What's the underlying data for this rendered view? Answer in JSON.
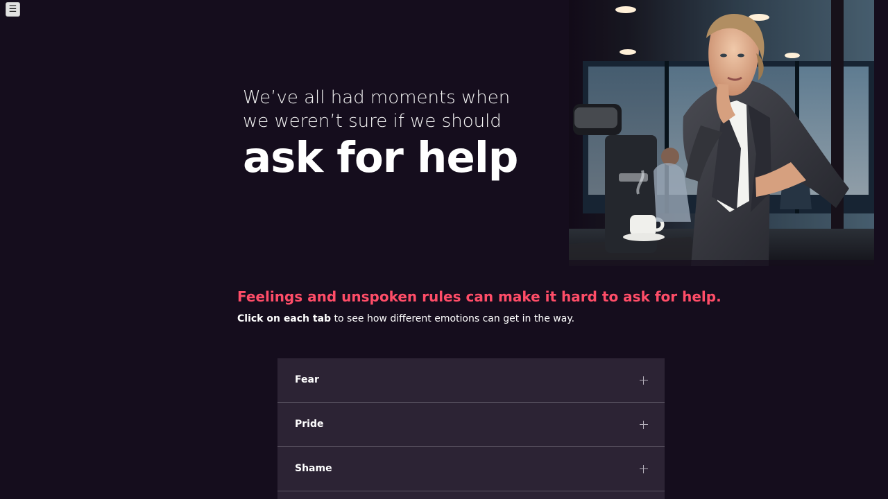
{
  "menu": {
    "icon": "menu-icon",
    "symbol": "☰"
  },
  "hero": {
    "line1": "We’ve all had moments when",
    "line2": "we weren’t sure if we should",
    "strong": "ask for help"
  },
  "section": {
    "title": "Feelings and unspoken rules can make it hard to ask for help.",
    "subtitle_strong": "Click on each tab",
    "subtitle_rest": " to see how different emotions can get in the way."
  },
  "accordion": {
    "items": [
      {
        "label": "Fear",
        "icon": "plus-icon"
      },
      {
        "label": "Pride",
        "icon": "plus-icon"
      },
      {
        "label": "Shame",
        "icon": "plus-icon"
      }
    ]
  },
  "colors": {
    "background": "#150d1d",
    "accent": "#ff4d68",
    "panel": "#2c2334"
  }
}
